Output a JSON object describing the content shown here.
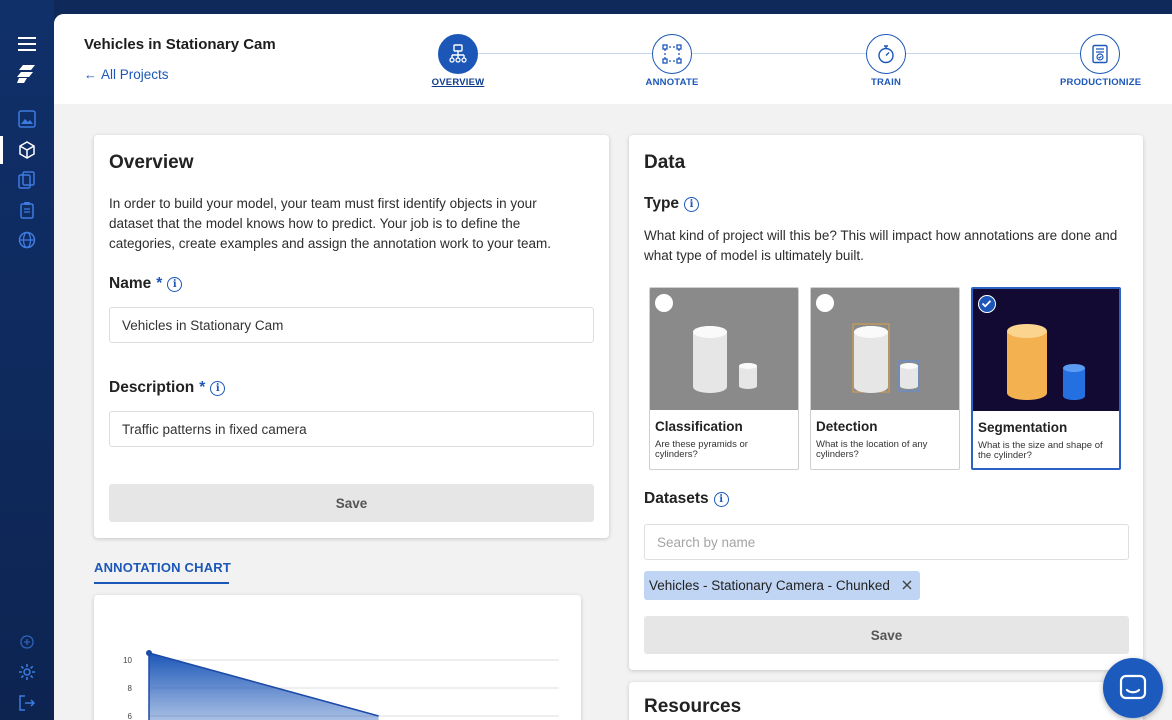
{
  "header": {
    "project_title": "Vehicles in Stationary Cam",
    "back_link": "All Projects"
  },
  "steps": [
    {
      "label": "OVERVIEW",
      "active": true
    },
    {
      "label": "ANNOTATE",
      "active": false
    },
    {
      "label": "TRAIN",
      "active": false
    },
    {
      "label": "PRODUCTIONIZE",
      "active": false
    }
  ],
  "overview": {
    "title": "Overview",
    "description": "In order to build your model, your team must first identify objects in your dataset that the model knows how to predict. Your job is to define the categories, create examples and assign the annotation work to your team.",
    "name_label": "Name",
    "name_value": "Vehicles in Stationary Cam",
    "description_label": "Description",
    "description_value": "Traffic patterns in fixed camera",
    "save_label": "Save",
    "required_mark": "*"
  },
  "annotation_chart_tab": "ANNOTATION CHART",
  "data": {
    "title": "Data",
    "type_label": "Type",
    "type_description": "What kind of project will this be? This will impact how annotations are done and what type of model is ultimately built.",
    "options": [
      {
        "title": "Classification",
        "desc": "Are these pyramids or cylinders?",
        "selected": false
      },
      {
        "title": "Detection",
        "desc": "What is the location of any cylinders?",
        "selected": false
      },
      {
        "title": "Segmentation",
        "desc": "What is the size and shape of the cylinder?",
        "selected": true
      }
    ],
    "datasets_label": "Datasets",
    "search_placeholder": "Search by name",
    "chip_label": "Vehicles - Stationary Camera - Chunked",
    "save_label": "Save"
  },
  "resources": {
    "title": "Resources"
  },
  "chart_data": {
    "type": "area",
    "y_ticks": [
      "10",
      "8",
      "6"
    ],
    "series": [
      {
        "x": [
          0,
          1
        ],
        "y": [
          10.5,
          6
        ]
      }
    ],
    "ylim": [
      6,
      10.5
    ],
    "grid": true
  },
  "colors": {
    "accent": "#1c57b8",
    "sidebar": "#10306a",
    "selected_image_bg": "#130a33"
  }
}
